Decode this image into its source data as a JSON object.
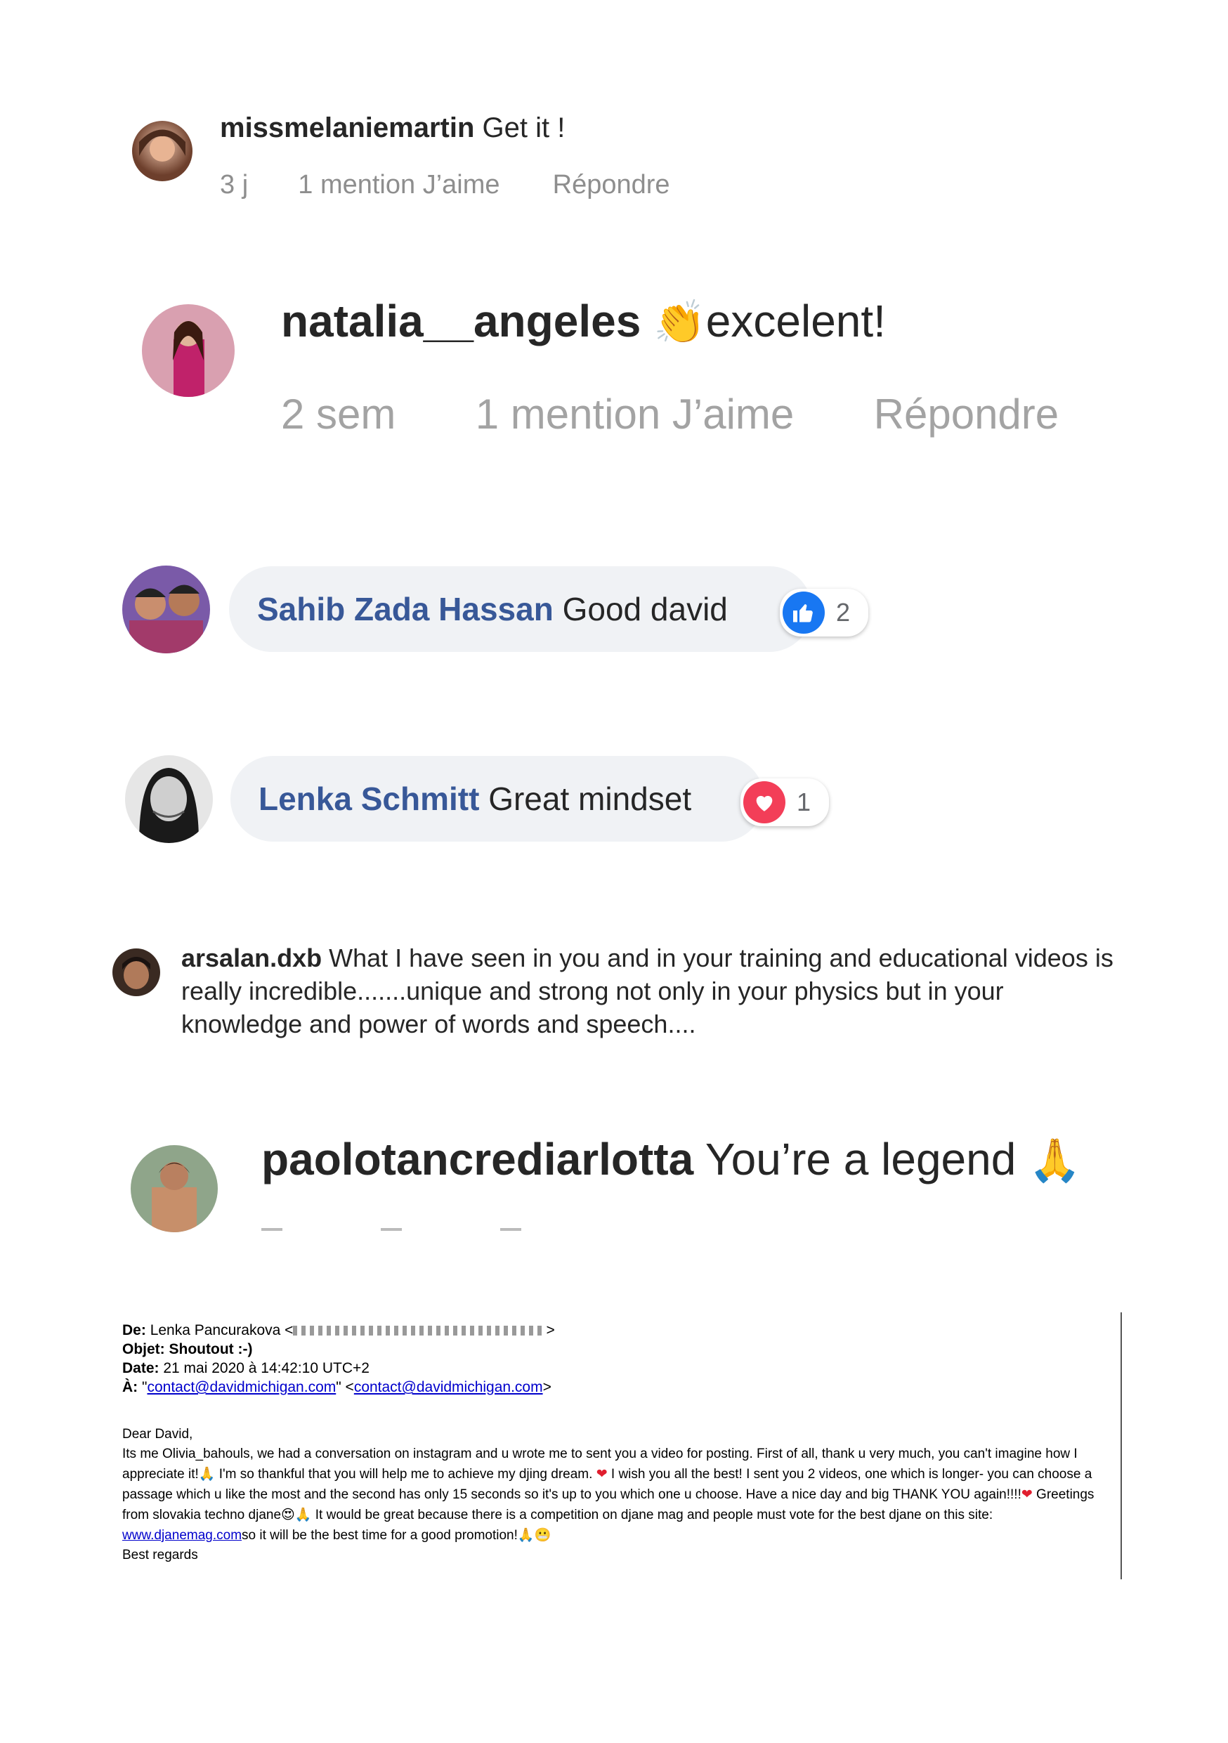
{
  "comments": [
    {
      "username": "missmelaniemartin",
      "text": "Get it !",
      "time": "3 j",
      "likes": "1 mention J’aime",
      "reply": "Répondre"
    },
    {
      "username": "natalia__angeles",
      "emoji": "👏",
      "text": "excelent!",
      "time": "2 sem",
      "likes": "1 mention J’aime",
      "reply": "Répondre"
    },
    {
      "username": "Sahib Zada Hassan",
      "text": "Good david",
      "reaction_count": "2",
      "reaction_icon": "thumbs-up-icon",
      "reaction_color": "#1877f2"
    },
    {
      "username": "Lenka Schmitt",
      "text": "Great mindset",
      "reaction_count": "1",
      "reaction_icon": "heart-icon",
      "reaction_color": "#f33e58"
    },
    {
      "username": "arsalan.dxb",
      "text": "What I have seen in you and in your training and educational videos is really incredible.......unique and strong not only in your physics but in your knowledge and power of words and speech...."
    },
    {
      "username": "paolotancrediarlotta",
      "text": "You’re a legend",
      "emoji": "🙏"
    }
  ],
  "email": {
    "from_label": "De:",
    "from_name": "Lenka Pancurakova",
    "subject_label": "Objet:",
    "subject": "Shoutout :-)",
    "date_label": "Date:",
    "date": "21 mai 2020 à 14:42:10 UTC+2",
    "to_label": "À:",
    "to_quoted": "contact@davidmichigan.com",
    "to_email": "contact@davidmichigan.com",
    "greeting": "Dear David,",
    "body_1": "Its me Olivia_bahouls, we had a conversation on instagram and u wrote me to sent you a video for posting. First of all, thank u very much, you can't imagine how I appreciate it!",
    "body_2": " I'm so thankful that you will help me to achieve my djing dream. ",
    "body_3": " I wish you all the best! I sent you 2 videos, one which is longer- you can choose a passage which u like the most and the second has only 15 seconds so it's up to you which one u choose. Have a nice day and big THANK YOU again!!!!",
    "body_4": " Greetings from slovakia techno djane",
    "body_5": " It would be great because there is a competition on djane mag and people must vote for the best djane on this site: ",
    "link": "www.djanemag.com",
    "body_6": "so it will be the best time for a good promotion!",
    "signoff": "Best regards"
  },
  "colors": {
    "link": "#0000cc",
    "fb_name": "#385898",
    "meta": "#8e8e8e",
    "bubble": "#f0f2f5"
  }
}
